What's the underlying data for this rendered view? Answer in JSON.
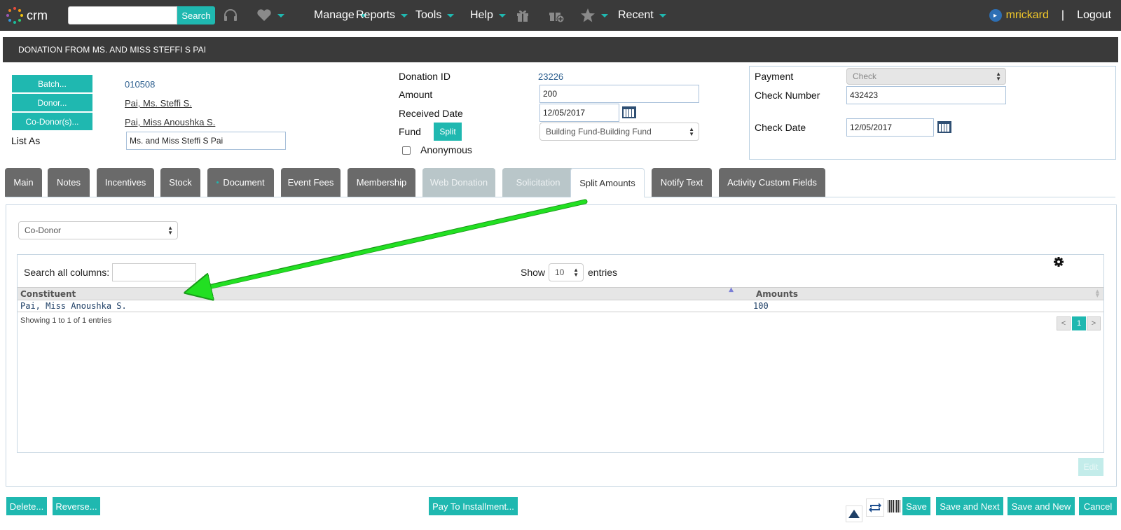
{
  "topnav": {
    "logo_text": "crm",
    "search_placeholder": "",
    "search_label": "Search",
    "menus": [
      "Manage",
      "Reports",
      "Tools",
      "Help",
      "Recent"
    ],
    "username": "mrickard",
    "separator": "|",
    "logout": "Logout"
  },
  "header": {
    "title": "DONATION FROM MS. AND MISS STEFFI S PAI"
  },
  "form": {
    "batch_label": "Batch...",
    "batch_value": "010508",
    "donor_label": "Donor...",
    "donor_value": "Pai, Ms. Steffi S.",
    "codonor_label": "Co-Donor(s)...",
    "codonor_value": "Pai, Miss Anoushka S.",
    "list_as_label": "List As",
    "list_as_value": "Ms. and Miss Steffi S Pai",
    "donation_id_label": "Donation ID",
    "donation_id_value": "23226",
    "amount_label": "Amount",
    "amount_value": "200",
    "received_date_label": "Received Date",
    "received_date_value": "12/05/2017",
    "fund_label": "Fund",
    "split_label": "Split",
    "fund_value": "Building Fund-Building Fund",
    "anonymous_label": "Anonymous",
    "payment_label": "Payment",
    "payment_value": "Check",
    "check_number_label": "Check Number",
    "check_number_value": "432423",
    "check_date_label": "Check Date",
    "check_date_value": "12/05/2017"
  },
  "tabs": [
    "Main",
    "Notes",
    "Incentives",
    "Stock",
    "Document",
    "Event Fees",
    "Membership",
    "Web Donation",
    "Solicitation",
    "Split Amounts",
    "Notify Text",
    "Activity Custom Fields"
  ],
  "split": {
    "type_select": "Co-Donor",
    "search_label": "Search all columns:",
    "show_label": "Show",
    "entries_value": "10",
    "entries_label": "entries",
    "columns": [
      "Constituent",
      "Amounts"
    ],
    "rows": [
      {
        "constituent": "Pai, Miss Anoushka S.",
        "amount": "100"
      }
    ],
    "info": "Showing 1 to 1 of 1 entries",
    "pagination": [
      "<",
      "1",
      ">"
    ],
    "edit_label": "Edit"
  },
  "footer": {
    "delete": "Delete...",
    "reverse": "Reverse...",
    "pay_installment": "Pay To Installment...",
    "save": "Save",
    "save_next": "Save and Next",
    "save_new": "Save and New",
    "cancel": "Cancel"
  },
  "colors": {
    "accent": "#1fb8b0",
    "nav_bg": "#3a3a3a",
    "tab_bg": "#6a6a6a",
    "arrow": "#22e022"
  }
}
